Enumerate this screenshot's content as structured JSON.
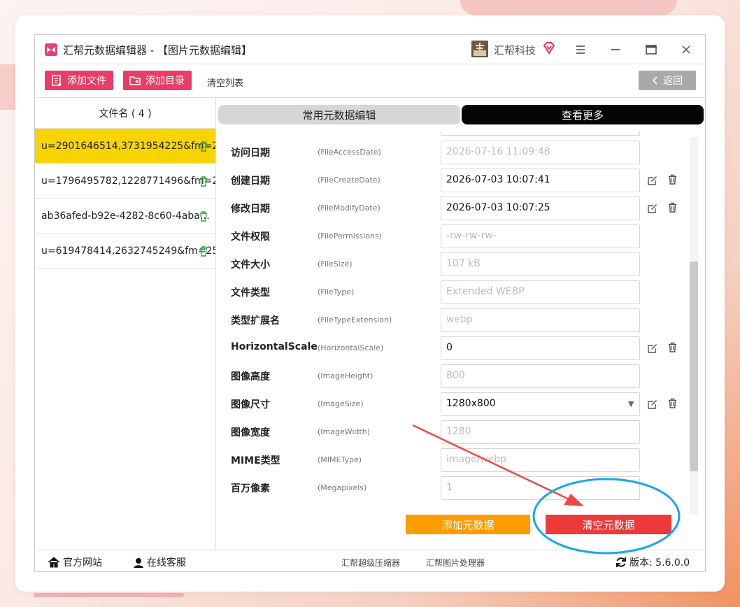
{
  "window": {
    "title": "汇帮元数据编辑器 - 【图片元数据编辑】",
    "brand": "汇帮科技"
  },
  "toolbar": {
    "add_file": "添加文件",
    "add_folder": "添加目录",
    "clear_list": "清空列表",
    "back": "返回"
  },
  "files": {
    "header": "文件名 ( 4 )",
    "items": [
      {
        "name": "u=2901646514,3731954225&fm=2…"
      },
      {
        "name": "u=1796495782,1228771496&fm=2…"
      },
      {
        "name": "ab36afed-b92e-4282-8c60-4aba…"
      },
      {
        "name": "u=619478414,2632745249&fm=25…"
      }
    ]
  },
  "tabs": {
    "common": "常用元数据编辑",
    "more": "查看更多"
  },
  "fields": [
    {
      "label": "访问日期",
      "key": "(FileAccessDate)",
      "value": "2026-07-16 11:09:48",
      "editable": false
    },
    {
      "label": "创建日期",
      "key": "(FileCreateDate)",
      "value": "2026-07-03 10:07:41",
      "editable": true
    },
    {
      "label": "修改日期",
      "key": "(FileModifyDate)",
      "value": "2026-07-03 10:07:25",
      "editable": true
    },
    {
      "label": "文件权限",
      "key": "(FilePermissions)",
      "value": "-rw-rw-rw-",
      "editable": false
    },
    {
      "label": "文件大小",
      "key": "(FileSize)",
      "value": "107 kB",
      "editable": false
    },
    {
      "label": "文件类型",
      "key": "(FileType)",
      "value": "Extended WEBP",
      "editable": false
    },
    {
      "label": "类型扩展名",
      "key": "(FileTypeExtension)",
      "value": "webp",
      "editable": false
    },
    {
      "label": "HorizontalScale",
      "key": "(HorizontalScale)",
      "value": "0",
      "editable": true
    },
    {
      "label": "图像高度",
      "key": "(ImageHeight)",
      "value": "800",
      "editable": false
    },
    {
      "label": "图像尺寸",
      "key": "(ImageSize)",
      "value": "1280x800",
      "editable": true,
      "dropdown": true
    },
    {
      "label": "图像宽度",
      "key": "(ImageWidth)",
      "value": "1280",
      "editable": false
    },
    {
      "label": "MIME类型",
      "key": "(MIMEType)",
      "value": "image/webp",
      "editable": false
    },
    {
      "label": "百万像素",
      "key": "(Megapixels)",
      "value": "1",
      "editable": false
    }
  ],
  "actions": {
    "add_meta": "添加元数据",
    "clear_meta": "清空元数据"
  },
  "footer": {
    "website": "官方网站",
    "support": "在线客服",
    "compressor": "汇帮超级压缩器",
    "image_tool": "汇帮图片处理器",
    "version": "版本: 5.6.0.0"
  },
  "colors": {
    "accent": "#ea3c69",
    "selected_row": "#f5d400",
    "add_button": "#ff9c00",
    "clear_button": "#ec3a3a",
    "annotation_circle": "#1aa6ee",
    "annotation_arrow": "#ef4848"
  }
}
